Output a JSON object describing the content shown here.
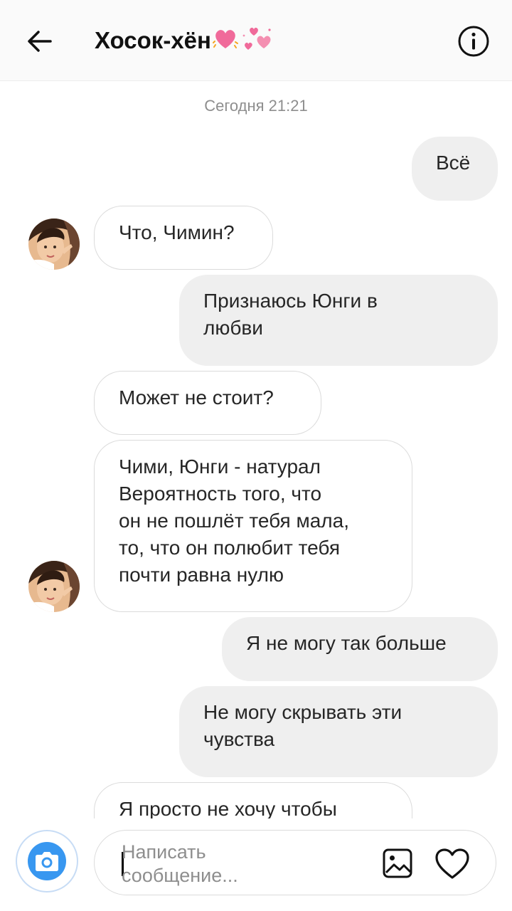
{
  "header": {
    "title": "Хосок-хён",
    "back_icon": "arrow-left-icon",
    "info_icon": "info-icon"
  },
  "chat": {
    "timestamp": "Сегодня 21:21",
    "messages": [
      {
        "direction": "out",
        "text": "Всё"
      },
      {
        "direction": "in",
        "text": "Что, Чимин?"
      },
      {
        "direction": "out",
        "text": "Признаюсь Юнги в\nлюбви"
      },
      {
        "direction": "in",
        "text": "Может не стоит?"
      },
      {
        "direction": "in",
        "text": "Чими, Юнги - натурал\nВероятность того, что\nон не пошлёт тебя мала,\nто, что он полюбит тебя\nпочти равна нулю"
      },
      {
        "direction": "out",
        "text": "Я не могу так больше"
      },
      {
        "direction": "out",
        "text": "Не могу скрывать эти\nчувства"
      },
      {
        "direction": "in",
        "text": "Я просто не хочу чтобы"
      }
    ]
  },
  "composer": {
    "placeholder": "Написать\nсообщение...",
    "camera_icon": "camera-icon",
    "gallery_icon": "gallery-icon",
    "heart_icon": "heart-icon"
  },
  "colors": {
    "accent": "#3897f0",
    "outgoing_bubble": "#efefef",
    "incoming_border": "#dbdbdb",
    "heart_emoji": "#f06a9a"
  }
}
